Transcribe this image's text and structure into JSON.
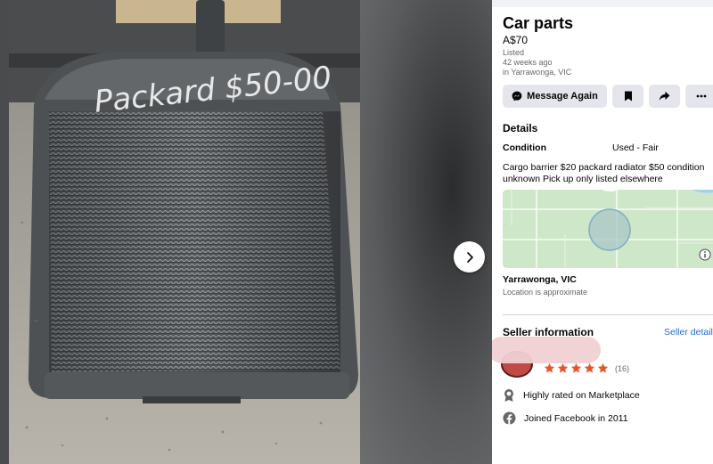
{
  "listing": {
    "title": "Car parts",
    "price": "A$70",
    "listed_label": "Listed",
    "listed_time": "42 weeks ago",
    "listed_location": "in Yarrawonga, VIC"
  },
  "actions": {
    "message_label": "Message Again"
  },
  "details": {
    "heading": "Details",
    "condition_label": "Condition",
    "condition_value": "Used - Fair",
    "description": "Cargo barrier $20 packard radiator $50 condition unknown Pick up only listed elsewhere"
  },
  "location": {
    "name": "Yarrawonga, VIC",
    "note": "Location is approximate"
  },
  "seller": {
    "heading": "Seller information",
    "details_link": "Seller details",
    "rating_stars": 5,
    "review_count": "(16)",
    "badges": [
      {
        "icon": "award-ribbon-icon",
        "text": "Highly rated on Marketplace"
      },
      {
        "icon": "facebook-icon",
        "text": "Joined Facebook in 2011"
      }
    ]
  },
  "photo": {
    "handwritten_text": "Packard $50-00"
  },
  "colors": {
    "accent_link": "#216fdb",
    "button_bg": "#e4e6eb",
    "star": "#e4572e",
    "map_green": "#cde8c9"
  }
}
